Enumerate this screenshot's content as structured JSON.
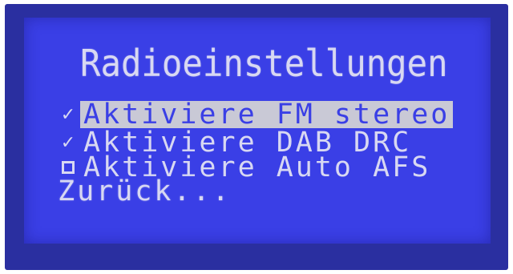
{
  "screen": {
    "title": "Radioeinstellungen",
    "items": [
      {
        "label": "Aktiviere FM stereo",
        "checked": true,
        "selected": true
      },
      {
        "label": "Aktiviere DAB DRC",
        "checked": true,
        "selected": false
      },
      {
        "label": "Aktiviere Auto AFS",
        "checked": false,
        "selected": false
      }
    ],
    "back_label": "Zurück...",
    "check_glyph": "✓"
  },
  "colors": {
    "lcd_background": "#3a3fe6",
    "text": "#d8d8f2",
    "selection_bar": "#c9c9d6"
  }
}
